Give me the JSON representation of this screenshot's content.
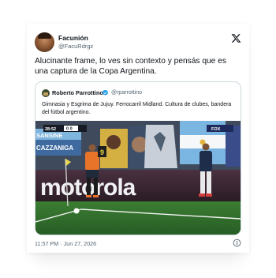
{
  "tweet": {
    "author_name": "Facunión",
    "author_handle": "@FacuRdrgz",
    "text": "Alucinante frame, lo ves sin contexto y pensás que es una captura de la Copa Argentina.",
    "timestamp": "11:57 PM · Jun 27, 2026",
    "logo_icon": "x-logo-icon",
    "info_icon": "info-icon"
  },
  "quoted_tweet": {
    "author_name": "Roberto Parrottino",
    "author_handle": "@rparrottino",
    "verified": true,
    "verified_color": "#1d9bf0",
    "text": "Gimnasia y Esgrima de Jujuy. Ferrocarril Midland. Cultura de clubes, bandera del fútbol argentino."
  },
  "broadcast": {
    "clock": "28:52",
    "score": "0 0",
    "network": "FOX",
    "board_text": "motorola",
    "banner_left": "SANSINE",
    "banner_left_2": "CAZZANIGA",
    "player_number": "9"
  },
  "colors": {
    "text_primary": "#0f1419",
    "text_secondary": "#536471",
    "border": "#cfd9de",
    "pitch": "#2f6b2c",
    "board": "#3a2733",
    "accent": "#1d9bf0"
  }
}
